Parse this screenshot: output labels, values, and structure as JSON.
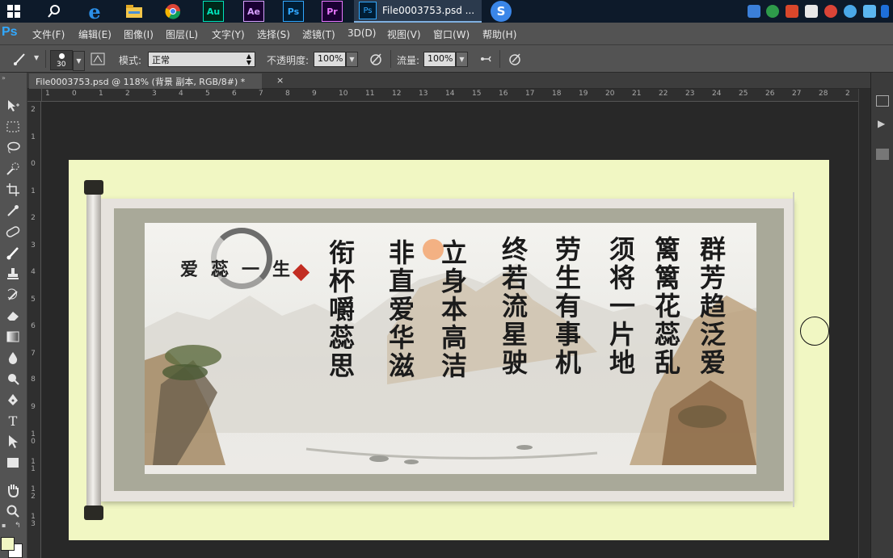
{
  "taskbar": {
    "apps": [
      {
        "name": "start",
        "label": ""
      },
      {
        "name": "search",
        "label": ""
      },
      {
        "name": "ie",
        "label": "e"
      },
      {
        "name": "explorer",
        "label": ""
      },
      {
        "name": "chrome",
        "label": ""
      },
      {
        "name": "audition",
        "label": "Au"
      },
      {
        "name": "after-effects",
        "label": "Ae"
      },
      {
        "name": "photoshop",
        "label": "Ps"
      },
      {
        "name": "premiere",
        "label": "Pr"
      }
    ],
    "active_window": {
      "icon": "Ps",
      "label": "File0003753.psd ..."
    },
    "sogou": "S"
  },
  "menubar": {
    "logo": "Ps",
    "items": [
      "文件(F)",
      "编辑(E)",
      "图像(I)",
      "图层(L)",
      "文字(Y)",
      "选择(S)",
      "滤镜(T)",
      "3D(D)",
      "视图(V)",
      "窗口(W)",
      "帮助(H)"
    ]
  },
  "options": {
    "brush_size": "30",
    "mode_label": "模式:",
    "mode_value": "正常",
    "opacity_label": "不透明度:",
    "opacity_value": "100%",
    "flow_label": "流量:",
    "flow_value": "100%"
  },
  "document": {
    "tab_title": "File0003753.psd @ 118% (背景 副本, RGB/8#) *",
    "close": "×"
  },
  "rulers": {
    "h_ticks": [
      "1",
      "0",
      "1",
      "2",
      "3",
      "4",
      "5",
      "6",
      "7",
      "8",
      "9",
      "10",
      "11",
      "12",
      "13",
      "14",
      "15",
      "16",
      "17",
      "18",
      "19",
      "20",
      "21",
      "22",
      "23",
      "24",
      "25",
      "26",
      "27",
      "28",
      "2"
    ],
    "v_ticks": [
      "2",
      "1",
      "0",
      "1",
      "2",
      "3",
      "4",
      "5",
      "6",
      "7",
      "8",
      "9",
      "10",
      "11",
      "12",
      "13"
    ]
  },
  "artwork": {
    "poem_columns": [
      "群芳趋泛爱",
      "篱篱花蕊乱",
      "须将一片地",
      "劳生有事机",
      "终若流星驶",
      "立身本高洁",
      "非直爱华滋",
      "衔杯嚼蕊思"
    ],
    "signature": "爱蕊一生"
  },
  "colors": {
    "accent": "#31a8ff",
    "canvas_bg": "#f1f7c3",
    "seal": "#c22d22"
  }
}
